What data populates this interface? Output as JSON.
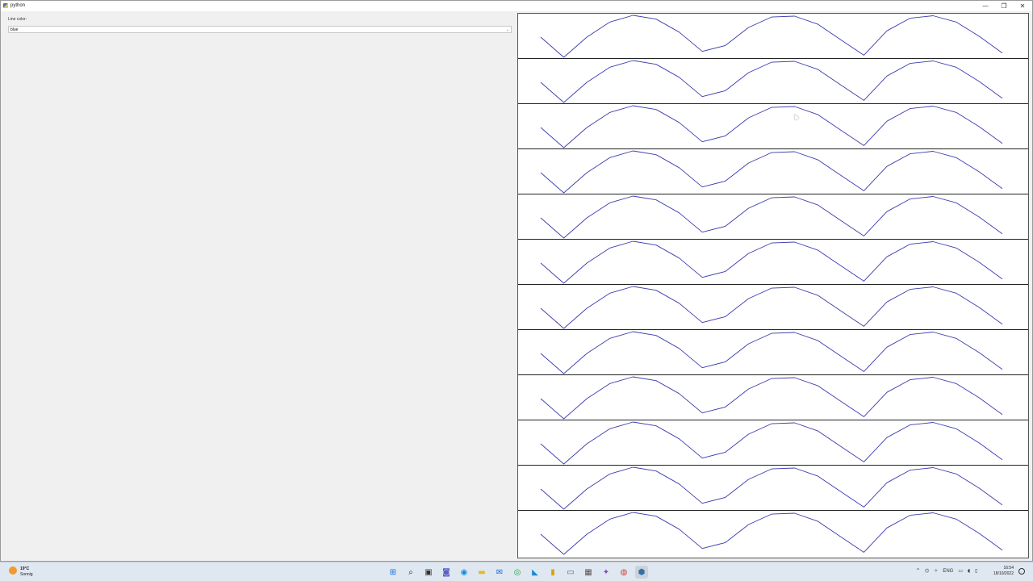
{
  "window": {
    "title": "python",
    "minimize": "—",
    "maximize": "❐",
    "close": "✕"
  },
  "form": {
    "line_color_label": "Line color:",
    "line_color_value": "blue",
    "dropdown_arrow": "⌄"
  },
  "plot_panel": {
    "plot_count": 12,
    "line_color": "#3b3bb0",
    "chart_data": {
      "type": "line",
      "series": [
        {
          "x": [
            0,
            0.5,
            1,
            1.5,
            2,
            2.5,
            3,
            3.5,
            4,
            4.5,
            5,
            5.5,
            6,
            6.5,
            7,
            7.5,
            8,
            8.5,
            9,
            9.5,
            10
          ],
          "values": [
            0.48,
            0.0,
            0.48,
            0.84,
            1.0,
            0.91,
            0.6,
            0.14,
            0.28,
            0.71,
            0.96,
            0.98,
            0.79,
            0.42,
            0.05,
            0.63,
            0.93,
            0.99,
            0.84,
            0.5,
            0.1
          ]
        }
      ]
    }
  },
  "taskbar": {
    "weather_temp": "19°C",
    "weather_desc": "Sonnig",
    "apps": [
      {
        "name": "windows-start-icon",
        "glyph": "⊞",
        "color": "#1a73e8"
      },
      {
        "name": "search-icon",
        "glyph": "⌕",
        "color": "#222"
      },
      {
        "name": "task-view-icon",
        "glyph": "▣",
        "color": "#333"
      },
      {
        "name": "chat-icon",
        "glyph": "◙",
        "color": "#5b5fc7"
      },
      {
        "name": "edge-icon",
        "glyph": "◉",
        "color": "#0f8fd8"
      },
      {
        "name": "file-explorer-icon",
        "glyph": "▬",
        "color": "#e9b824"
      },
      {
        "name": "mail-icon",
        "glyph": "✉",
        "color": "#1a6fd8"
      },
      {
        "name": "chrome-icon",
        "glyph": "◎",
        "color": "#2da44e"
      },
      {
        "name": "vscode-icon",
        "glyph": "◣",
        "color": "#1f8ad8"
      },
      {
        "name": "app-yellow-icon",
        "glyph": "▮",
        "color": "#d9a400"
      },
      {
        "name": "app-monitor-icon",
        "glyph": "▭",
        "color": "#3a6aa8"
      },
      {
        "name": "calculator-icon",
        "glyph": "▦",
        "color": "#555"
      },
      {
        "name": "app-purple-icon",
        "glyph": "✦",
        "color": "#7b4fc8"
      },
      {
        "name": "app-red-icon",
        "glyph": "◍",
        "color": "#d83b3b"
      },
      {
        "name": "python-app-icon",
        "glyph": "⬢",
        "color": "#3670a0",
        "active": true
      }
    ],
    "tray": {
      "chevron": "^",
      "lang": "ENG"
    },
    "time": "16:54",
    "date": "18/10/2022"
  }
}
